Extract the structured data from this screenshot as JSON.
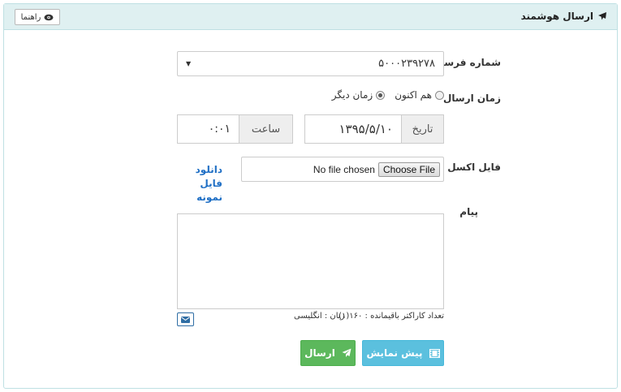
{
  "header": {
    "title": "ارسال هوشمند",
    "title_icon": "plane-icon",
    "help_label": "راهنما",
    "help_icon": "eye-icon",
    "bg_color": "#dff0f1"
  },
  "form": {
    "sender": {
      "label": "شماره فرستنده",
      "value": "۵۰۰۰۲۳۹۲۷۸"
    },
    "send_time": {
      "label": "زمان ارسال",
      "options": [
        {
          "label": "هم اکنون",
          "selected": false
        },
        {
          "label": "زمان دیگر",
          "selected": true
        }
      ]
    },
    "date": {
      "addon": "تاریخ",
      "value": "۱۳۹۵/۵/۱۰"
    },
    "time": {
      "addon": "ساعت",
      "value": "۰:۰۱"
    },
    "excel": {
      "label": "فایل اکسل",
      "choose_button": "Choose File",
      "file_status": "No file chosen",
      "download_link": "دانلود فایل نمونه"
    },
    "message": {
      "label": "پیام",
      "value": "",
      "char_count": "تعداد کاراکتر باقیمانده : ۱۶۰(۱)",
      "language": "زبان : انگلیسی",
      "mail_icon": "envelope-icon"
    }
  },
  "actions": {
    "preview_label": "پیش نمایش",
    "preview_icon": "film-icon",
    "send_label": "ارسال",
    "send_icon": "paper-plane-icon",
    "preview_color": "#5bc0de",
    "send_color": "#5cb85c"
  }
}
